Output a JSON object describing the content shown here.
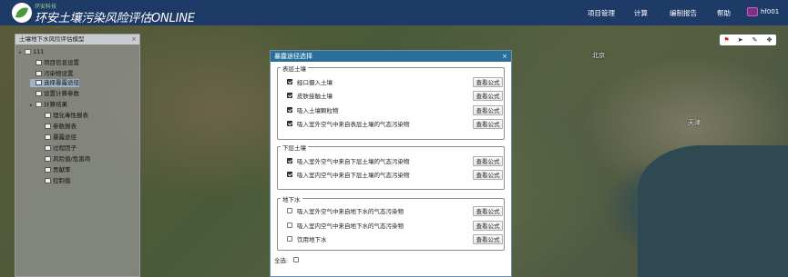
{
  "header": {
    "logo_small": "环安科技",
    "logo_title": "环安土壤污染风险评估ONLINE",
    "nav": [
      "项目管理",
      "计算",
      "编制报告",
      "帮助"
    ],
    "user": "hf001"
  },
  "map": {
    "labels": [
      "天津",
      "北京"
    ]
  },
  "left_panel": {
    "title": "土壤地下水风险评估模型",
    "close": "×",
    "tree": [
      {
        "label": "111",
        "level": 0,
        "type": "folder"
      },
      {
        "label": "项目信息设置",
        "level": 1,
        "type": "doc"
      },
      {
        "label": "污染物设置",
        "level": 1,
        "type": "doc"
      },
      {
        "label": "选择暴露途径",
        "level": 1,
        "type": "doc"
      },
      {
        "label": "设置计算参数",
        "level": 1,
        "type": "doc"
      },
      {
        "label": "计算结果",
        "level": 1,
        "type": "folder"
      },
      {
        "label": "理化毒性报表",
        "level": 2,
        "type": "doc"
      },
      {
        "label": "参数报表",
        "level": 2,
        "type": "doc"
      },
      {
        "label": "暴露途径",
        "level": 2,
        "type": "doc"
      },
      {
        "label": "过程因子",
        "level": 2,
        "type": "doc"
      },
      {
        "label": "风险值/危害商",
        "level": 2,
        "type": "doc"
      },
      {
        "label": "贡献率",
        "level": 2,
        "type": "doc"
      },
      {
        "label": "控制值",
        "level": 2,
        "type": "doc"
      }
    ]
  },
  "tools": [
    "flag-icon",
    "pointer-icon",
    "pencil-icon",
    "zoom-icon"
  ],
  "modal": {
    "title": "暴露途径选择",
    "close": "×",
    "groups": [
      {
        "title": "表层土壤",
        "options": [
          {
            "label": "经口摄入土壤",
            "checked": true,
            "button": "查看公式"
          },
          {
            "label": "皮肤接触土壤",
            "checked": true,
            "button": "查看公式"
          },
          {
            "label": "吸入土壤颗粒物",
            "checked": true,
            "button": "查看公式"
          },
          {
            "label": "吸入室外空气中来自表层土壤的气态污染物",
            "checked": true,
            "button": "查看公式"
          }
        ]
      },
      {
        "title": "下层土壤",
        "options": [
          {
            "label": "吸入室外空气中来自下层土壤的气态污染物",
            "checked": true,
            "button": "查看公式"
          },
          {
            "label": "吸入室内空气中来自下层土壤的气态污染物",
            "checked": true,
            "button": "查看公式"
          }
        ]
      },
      {
        "title": "地下水",
        "options": [
          {
            "label": "吸入室外空气中来自地下水的气态污染物",
            "checked": false,
            "button": "查看公式"
          },
          {
            "label": "吸入室内空气中来自地下水的气态污染物",
            "checked": false,
            "button": "查看公式"
          },
          {
            "label": "饮用地下水",
            "checked": false,
            "button": "查看公式"
          }
        ]
      }
    ],
    "select_all": "全选:"
  }
}
